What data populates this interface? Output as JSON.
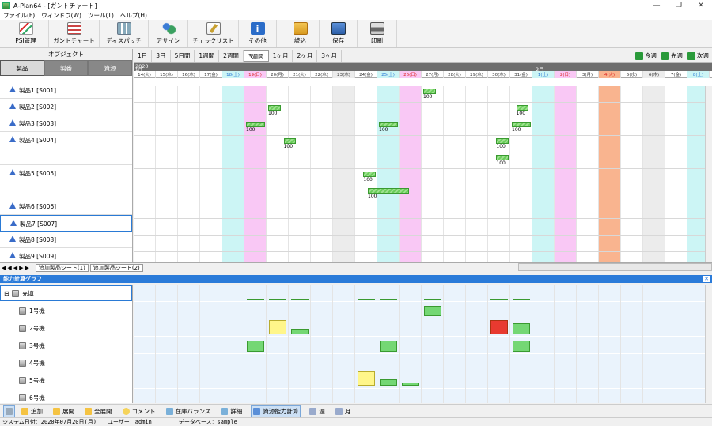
{
  "window": {
    "title": "A-Plan64 - [ガントチャート]",
    "controls": [
      "—",
      "❐",
      "✕"
    ]
  },
  "menu": [
    "ファイル(F)",
    "ウィンドウ(W)",
    "ツール(T)",
    "ヘルプ(H)"
  ],
  "toolbar": [
    {
      "label": "PSI管理",
      "icon": "psi-chart-icon"
    },
    {
      "label": "ガントチャート",
      "icon": "gantt-icon"
    },
    {
      "label": "ディスパッチ",
      "icon": "dispatch-icon"
    },
    {
      "label": "アサイン",
      "icon": "assign-people-icon"
    },
    {
      "label": "チェックリスト",
      "icon": "checklist-icon"
    },
    {
      "label": "その他",
      "icon": "info-icon"
    },
    {
      "label": "読込",
      "icon": "folder-open-icon"
    },
    {
      "label": "保存",
      "icon": "save-icon"
    },
    {
      "label": "印刷",
      "icon": "print-icon"
    }
  ],
  "object_panel": {
    "header": "オブジェクト",
    "tabs": [
      "製品",
      "製番",
      "資源"
    ],
    "active_tab": "製品"
  },
  "products": [
    "製品1 [S001]",
    "製品2 [S002]",
    "製品3 [S003]",
    "製品4 [S004]",
    "製品5 [S005]",
    "製品6 [S006]",
    "製品7 [S007]",
    "製品8 [S008]",
    "製品9 [S009]"
  ],
  "selected_product": "製品7 [S007]",
  "range_buttons": [
    "1日",
    "3日",
    "5日間",
    "1週間",
    "2週間",
    "3週間",
    "1ヶ月",
    "2ヶ月",
    "3ヶ月"
  ],
  "active_range": "3週間",
  "nav": {
    "today": "今週",
    "prev": "先週",
    "next": "次週"
  },
  "timeline": {
    "year": "2020",
    "month1": "1月",
    "month2": "2月",
    "days": [
      "14(火)",
      "15(水)",
      "16(木)",
      "17(金)",
      "18(土)",
      "19(日)",
      "20(月)",
      "21(火)",
      "22(水)",
      "23(木)",
      "24(金)",
      "25(土)",
      "26(日)",
      "27(月)",
      "28(火)",
      "29(水)",
      "30(木)",
      "31(金)",
      "1(土)",
      "2(日)",
      "3(月)",
      "4(火)",
      "5(水)",
      "6(木)",
      "7(金)",
      "8(土)"
    ]
  },
  "gantt_bars": [
    {
      "row": 0,
      "day": 13,
      "span": 0.7,
      "label": "100"
    },
    {
      "row": 1,
      "day": 6,
      "span": 0.7,
      "label": "100"
    },
    {
      "row": 1,
      "day": 17.2,
      "span": 0.7,
      "label": "100"
    },
    {
      "row": 2,
      "day": 5,
      "span": 1,
      "label": "100"
    },
    {
      "row": 2,
      "day": 11,
      "span": 1,
      "label": "100"
    },
    {
      "row": 2,
      "day": 17,
      "span": 1,
      "label": "100"
    },
    {
      "row": 3,
      "day": 6.7,
      "span": 0.7,
      "label": "100"
    },
    {
      "row": 3,
      "day": 16.3,
      "span": 0.7,
      "label": "100"
    },
    {
      "row": 3.5,
      "day": 16.3,
      "span": 0.7,
      "label": "100"
    },
    {
      "row": 4,
      "day": 10.3,
      "span": 0.7,
      "label": "100"
    },
    {
      "row": 4.5,
      "day": 10.5,
      "span": 2,
      "label": "100"
    }
  ],
  "sheet_tabs": [
    "追加製品シート(1)",
    "追加製品シート(2)"
  ],
  "capacity": {
    "title": "能力計算グラフ",
    "group": "充填",
    "machines": [
      "1号機",
      "2号機",
      "3号機",
      "4号機",
      "5号機",
      "6号機"
    ]
  },
  "bottom_buttons": [
    "追加",
    "展開",
    "全展開",
    "コメント",
    "在庫バランス",
    "詳細",
    "資源能力計算",
    "週",
    "月"
  ],
  "status": {
    "date": "システム日付：2020年07月20日(月)",
    "user": "ユーザー：admin",
    "db": "データベース：sample"
  },
  "colors": {
    "saturday": "#ccf5f5",
    "sunday": "#f9c8f5",
    "holiday": "#f9b48f",
    "accent": "#2b7bd9",
    "bar": "#74d774"
  }
}
